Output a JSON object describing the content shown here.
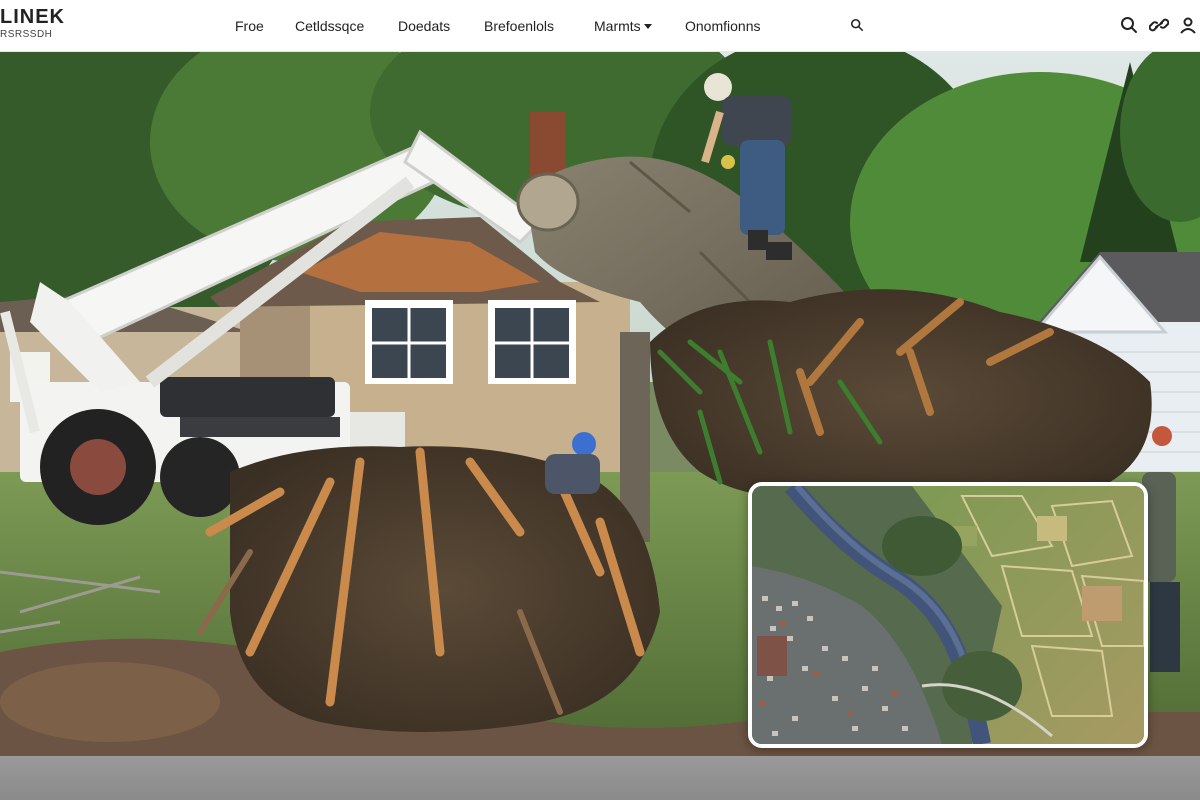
{
  "brand": {
    "title": "LINEK",
    "subtitle": "RSRSSDH"
  },
  "nav": {
    "items": [
      {
        "label": "Froe"
      },
      {
        "label": "Cetldssqce"
      },
      {
        "label": "Doedats"
      },
      {
        "label": "Brefoenlols"
      },
      {
        "label": "Marmts"
      },
      {
        "label": "Onomfionns"
      }
    ]
  },
  "icons": {
    "nav_search": "search-icon",
    "tool_search": "search-icon",
    "tool_link": "link-icon",
    "tool_account": "account-icon"
  },
  "hero": {
    "scene": "tree-removal-photo",
    "inset_scene": "aerial-map-photo"
  },
  "colors": {
    "header_bg": "#ffffff",
    "text": "#222222",
    "footer_bar": "#8f8f8f",
    "inset_border": "#ffffff"
  }
}
